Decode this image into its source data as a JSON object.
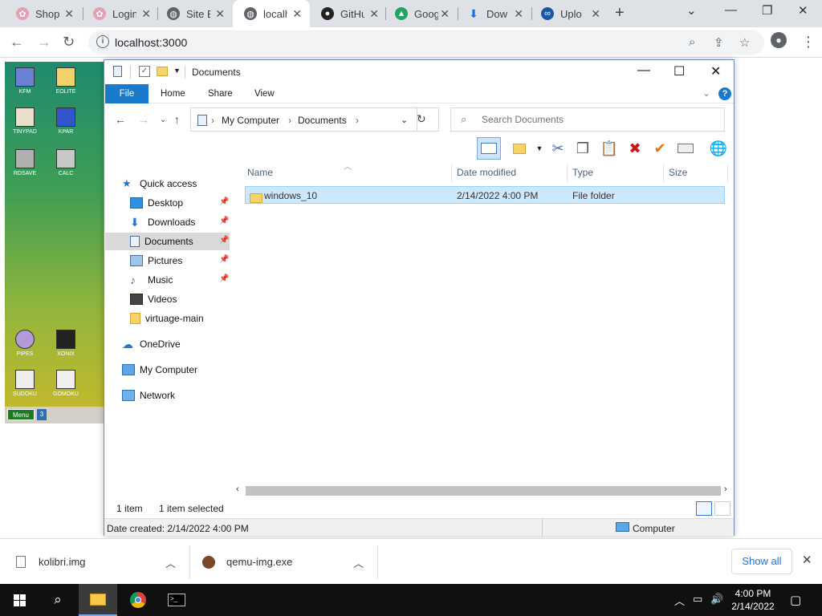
{
  "browser": {
    "tabs": [
      {
        "label": "Shop",
        "color": "#e6a0b4"
      },
      {
        "label": "Login",
        "color": "#e6a0b4"
      },
      {
        "label": "Site B",
        "color": "#5f6368"
      },
      {
        "label": "localh",
        "color": "#5f6368"
      },
      {
        "label": "GitHu",
        "color": "#222222"
      },
      {
        "label": "Goog",
        "color": "#1fa463"
      },
      {
        "label": "Dow",
        "color": "#1a73e8"
      },
      {
        "label": "Uplo",
        "color": "#1a56a8"
      }
    ],
    "url": "localhost:3000"
  },
  "desktop": {
    "icons": [
      {
        "label": "KFM",
        "color": "#6a7fd6"
      },
      {
        "label": "EOLITE",
        "color": "#f2d16b"
      },
      {
        "label": "TINYPAD",
        "color": "#e8e0c8"
      },
      {
        "label": "KPAR",
        "color": "#3355cc"
      },
      {
        "label": "RDSAVE",
        "color": "#b0b0b0"
      },
      {
        "label": "CALC",
        "color": "#c8c8c8"
      },
      {
        "label": "PIPES",
        "color": "#b49ad6"
      },
      {
        "label": "XONIX",
        "color": "#222222"
      },
      {
        "label": "SUDOKU",
        "color": "#eeeeee"
      },
      {
        "label": "GOMOKU",
        "color": "#f0f0f0"
      }
    ],
    "menu_label": "Menu",
    "button_label": "3"
  },
  "explorer": {
    "title": "Documents",
    "ribbon_tabs": [
      "File",
      "Home",
      "Share",
      "View"
    ],
    "help": "?",
    "breadcrumbs": [
      "My Computer",
      "Documents"
    ],
    "search_placeholder": "Search Documents",
    "nav": {
      "quick_access": "Quick access",
      "items": [
        "Desktop",
        "Downloads",
        "Documents",
        "Pictures",
        "Music",
        "Videos",
        "virtuage-main"
      ],
      "onedrive": "OneDrive",
      "my_computer": "My Computer",
      "network": "Network"
    },
    "columns": [
      "Name",
      "Date modified",
      "Type",
      "Size"
    ],
    "files": [
      {
        "name": "windows_10",
        "date": "2/14/2022 4:00 PM",
        "type": "File folder",
        "size": ""
      }
    ],
    "status": {
      "count": "1 item",
      "selected": "1 item selected",
      "date_created": "Date created: 2/14/2022 4:00 PM",
      "location": "Computer"
    }
  },
  "downloads": {
    "items": [
      "kolibri.img",
      "qemu-img.exe"
    ],
    "show_all": "Show all"
  },
  "taskbar": {
    "time": "4:00 PM",
    "date": "2/14/2022"
  }
}
